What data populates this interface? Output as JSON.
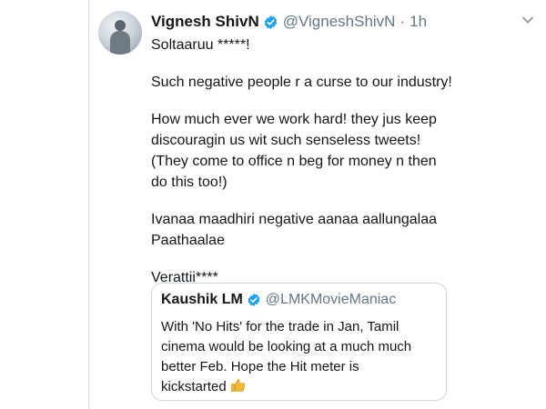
{
  "tweet": {
    "author_name": "Vignesh ShivN",
    "author_handle": "@VigneshShivN",
    "separator": "·",
    "time": "1h",
    "lines": [
      "Soltaaruu *****!",
      "Such negative people r a curse to our industry!",
      "How much ever we work hard! they jus keep",
      "discouragin us wit such senseless tweets!",
      "(They come to office n beg for money n then",
      "do this too!)",
      "Ivanaa maadhiri negative aanaa aallungalaa",
      "Paathaalae",
      "Verattii****"
    ]
  },
  "quoted_tweet": {
    "author_name": "Kaushik LM",
    "author_handle": "@LMKMovieManiac",
    "lines": [
      "With 'No Hits' for the trade in Jan, Tamil",
      "cinema would be looking at a much much",
      "better Feb. Hope the Hit meter is",
      "kickstarted"
    ],
    "emoji_icon": "thumbs-up-icon"
  },
  "colors": {
    "verified_blue": "#1da1f2",
    "secondary_text": "#657786",
    "border": "#ccd6dd",
    "emoji_yellow": "#f5b82e"
  }
}
